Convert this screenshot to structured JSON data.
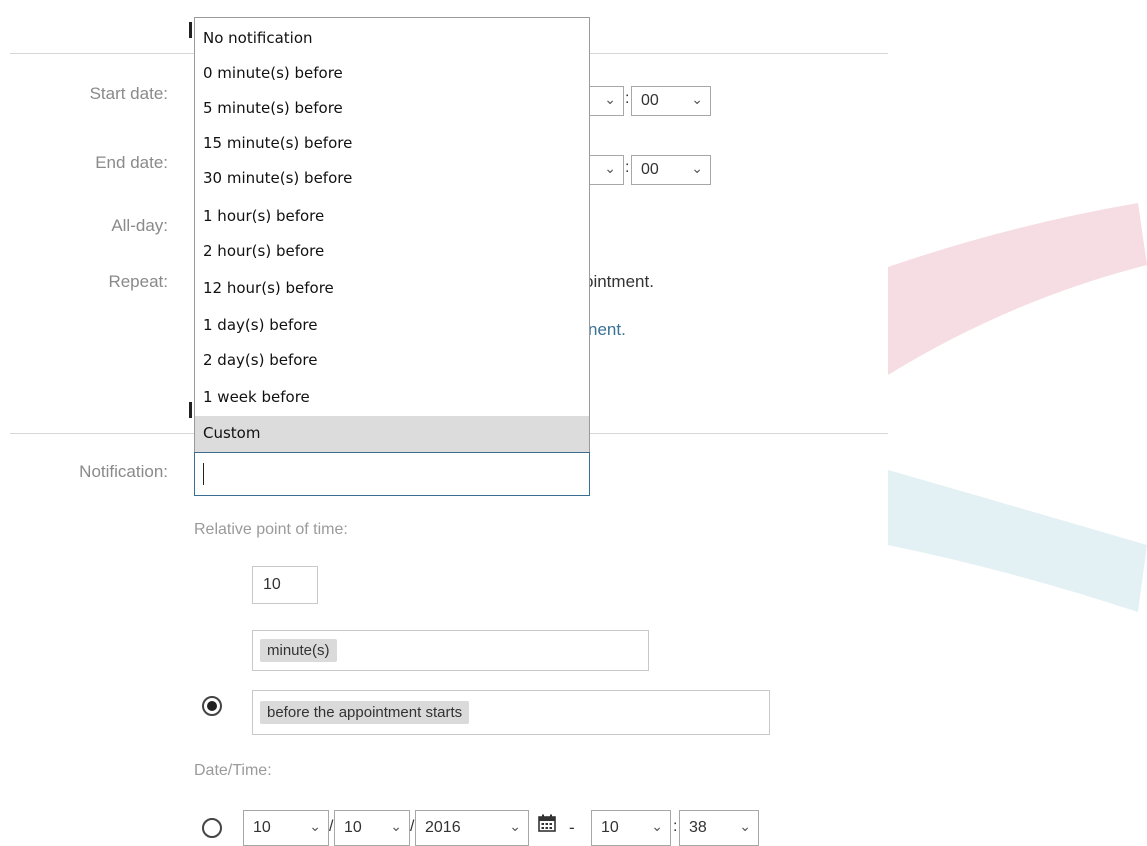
{
  "colors": {
    "arc_red": "#f6dde3",
    "arc_cyan": "#e3f1f4",
    "link": "#3a7296",
    "dropdown_border": "#3a6f93"
  },
  "labels": {
    "start_date": "Start date:",
    "end_date": "End date:",
    "all_day": "All-day:",
    "repeat": "Repeat:",
    "notification": "Notification:"
  },
  "start_time": {
    "minute": "00"
  },
  "end_time": {
    "minute": "00"
  },
  "repeat_text_partial": "ointment.",
  "repeat_link_partial": "nent.",
  "notification_dropdown": {
    "options": [
      "No notification",
      "0 minute(s) before",
      "5 minute(s) before",
      "15 minute(s) before",
      "30 minute(s) before",
      "1 hour(s) before",
      "2 hour(s) before",
      "12 hour(s) before",
      "1 day(s) before",
      "2 day(s) before",
      "1 week before",
      "Custom"
    ],
    "selected": "Custom",
    "search_value": ""
  },
  "relative": {
    "heading": "Relative point of time:",
    "amount": "10",
    "unit": "minute(s)",
    "anchor": "before the appointment starts"
  },
  "datetime": {
    "heading": "Date/Time:",
    "month": "10",
    "day": "10",
    "year": "2016",
    "dash": "-",
    "hour": "10",
    "minute": "38"
  }
}
